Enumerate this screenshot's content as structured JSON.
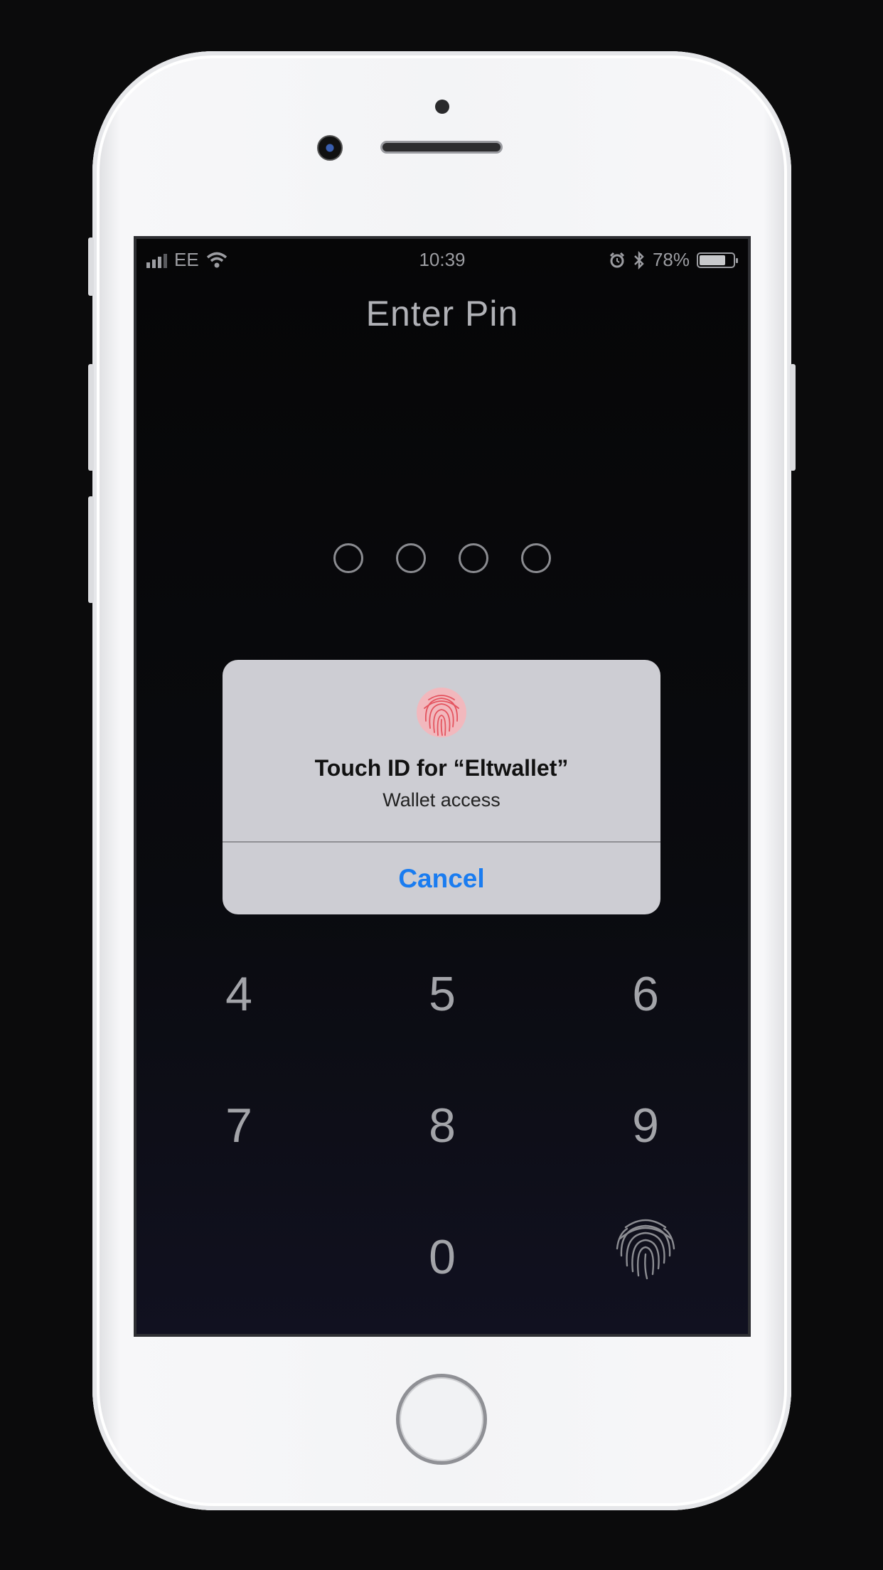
{
  "status_bar": {
    "carrier": "EE",
    "time": "10:39",
    "battery_percent": "78%",
    "battery_level": 0.78,
    "icons": [
      "signal-icon",
      "wifi-icon",
      "alarm-icon",
      "bluetooth-icon",
      "battery-icon"
    ]
  },
  "screen": {
    "title": "Enter Pin",
    "pin_length": 4
  },
  "keypad": {
    "keys": [
      "4",
      "5",
      "6",
      "7",
      "8",
      "9",
      "0"
    ],
    "fingerprint_icon": "fingerprint-icon"
  },
  "alert": {
    "icon": "fingerprint-icon",
    "icon_color": "#e4545f",
    "title": "Touch ID for “Eltwallet”",
    "message": "Wallet access",
    "cancel_label": "Cancel",
    "button_color": "#1a7cf0"
  }
}
